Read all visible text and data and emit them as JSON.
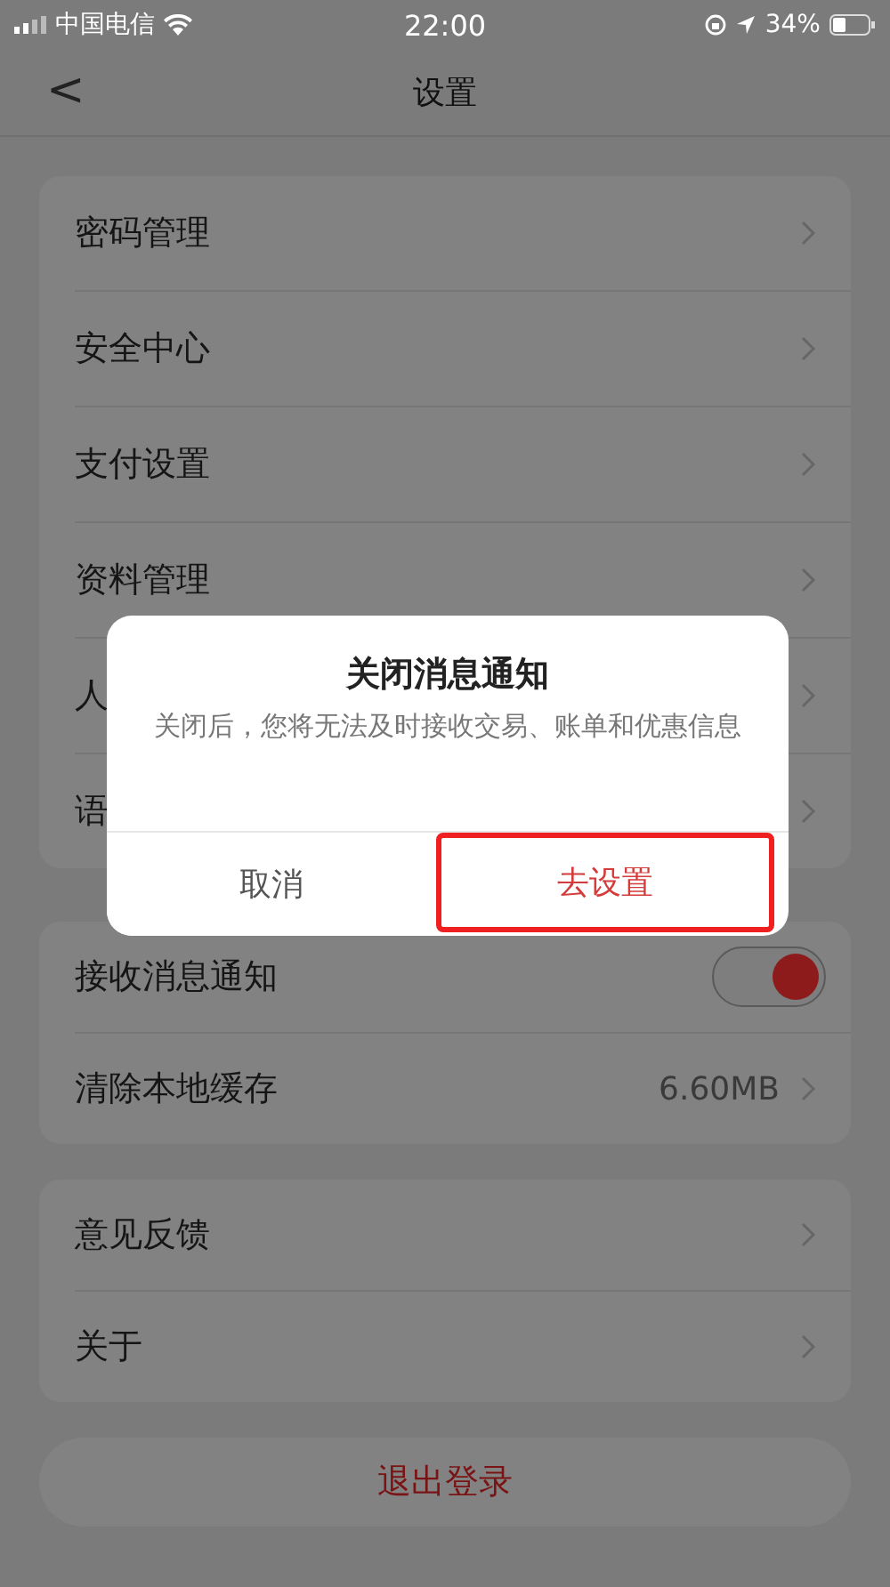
{
  "status_bar": {
    "carrier": "中国电信",
    "time": "22:00",
    "battery": "34%"
  },
  "nav": {
    "back": "<",
    "title": "设置"
  },
  "groups": [
    {
      "rows": [
        {
          "kind": "link",
          "label": "密码管理"
        },
        {
          "kind": "link",
          "label": "安全中心"
        },
        {
          "kind": "link",
          "label": "支付设置"
        },
        {
          "kind": "link",
          "label": "资料管理"
        },
        {
          "kind": "link",
          "label": "人"
        },
        {
          "kind": "link",
          "label": "语"
        }
      ]
    },
    {
      "rows": [
        {
          "kind": "toggle",
          "label": "接收消息通知",
          "on": true
        },
        {
          "kind": "link",
          "label": "清除本地缓存",
          "value": "6.60MB"
        }
      ]
    },
    {
      "rows": [
        {
          "kind": "link",
          "label": "意见反馈"
        },
        {
          "kind": "link",
          "label": "关于"
        }
      ]
    }
  ],
  "logout": "退出登录",
  "dialog": {
    "title": "关闭消息通知",
    "message": "关闭后，您将无法及时接收交易、账单和优惠信息",
    "buttons": [
      {
        "label": "取消",
        "kind": "cancel",
        "highlighted": false
      },
      {
        "label": "去设置",
        "kind": "confirm",
        "highlighted": true
      }
    ]
  }
}
